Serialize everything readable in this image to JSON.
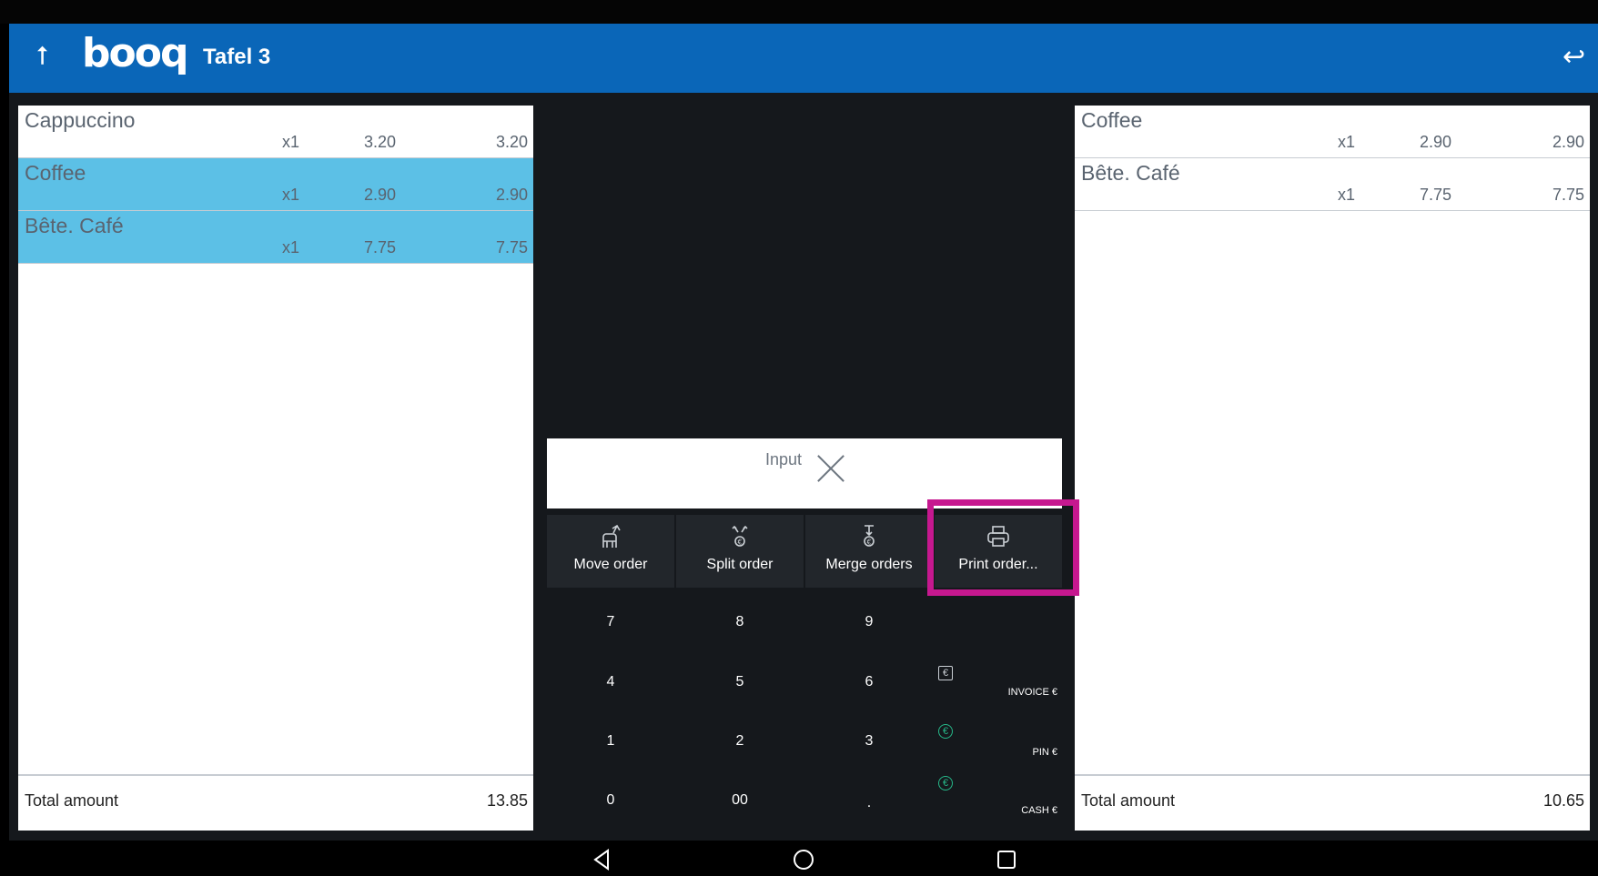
{
  "app": {
    "logo": "booq",
    "title": "Tafel 3"
  },
  "left_panel": {
    "items": [
      {
        "name": "Cappuccino",
        "qty": "x1",
        "unit_price": "3.20",
        "total": "3.20",
        "selected": false
      },
      {
        "name": "Coffee",
        "qty": "x1",
        "unit_price": "2.90",
        "total": "2.90",
        "selected": true
      },
      {
        "name": "Bête. Café",
        "qty": "x1",
        "unit_price": "7.75",
        "total": "7.75",
        "selected": true
      }
    ],
    "total_label": "Total amount",
    "total_amount": "13.85"
  },
  "right_panel": {
    "items": [
      {
        "name": "Coffee",
        "qty": "x1",
        "unit_price": "2.90",
        "total": "2.90"
      },
      {
        "name": "Bête. Café",
        "qty": "x1",
        "unit_price": "7.75",
        "total": "7.75"
      }
    ],
    "total_label": "Total amount",
    "total_amount": "10.65"
  },
  "input": {
    "label": "Input"
  },
  "actions": {
    "move_order": "Move order",
    "split_order": "Split order",
    "merge_orders": "Merge orders",
    "print_order": "Print order..."
  },
  "keypad": {
    "k7": "7",
    "k8": "8",
    "k9": "9",
    "k4": "4",
    "k5": "5",
    "k6": "6",
    "k1": "1",
    "k2": "2",
    "k3": "3",
    "k0": "0",
    "k00": "00",
    "kdot": "."
  },
  "payments": {
    "invoice": "INVOICE €",
    "pin": "PIN €",
    "cash": "CASH €",
    "euro_symbol": "€"
  },
  "colors": {
    "appbar": "#0a66b8",
    "selected_row": "#5cc0e6",
    "highlight": "#c6188f",
    "euro_icon": "#26b889"
  }
}
